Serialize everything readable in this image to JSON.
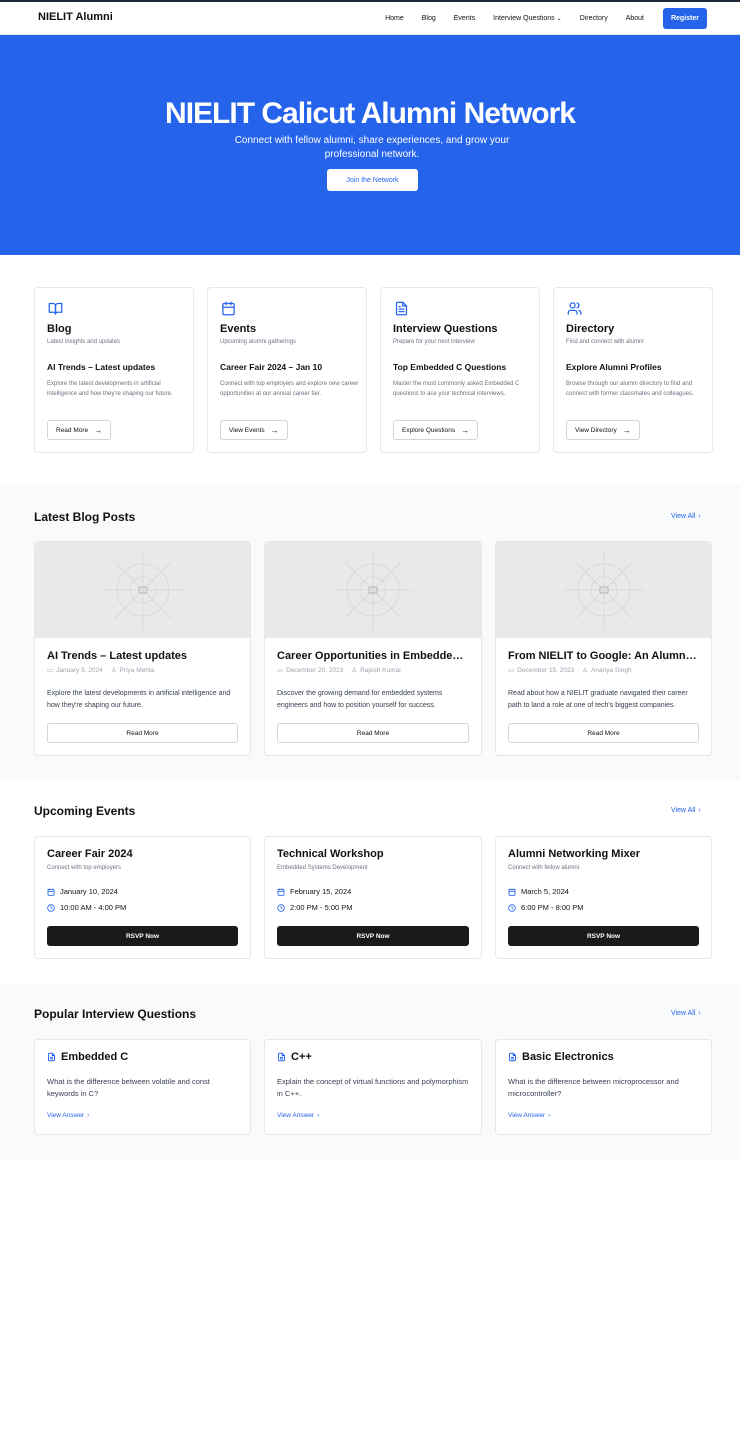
{
  "nav": {
    "logo": "NIELIT Alumni",
    "links": [
      "Home",
      "Blog",
      "Events",
      "Interview Questions",
      "Directory",
      "About"
    ],
    "register": "Register"
  },
  "hero": {
    "title": "NIELIT Calicut Alumni Network",
    "subtitle": "Connect with fellow alumni, share experiences, and grow your professional network.",
    "button": "Join the Network"
  },
  "features": [
    {
      "icon": "book-open-icon",
      "title": "Blog",
      "subtitle": "Latest insights and updates",
      "heading": "AI Trends – Latest updates",
      "description": "Explore the latest developments in artificial intelligence and how they're shaping our future.",
      "button": "Read More"
    },
    {
      "icon": "calendar-icon",
      "title": "Events",
      "subtitle": "Upcoming alumni gatherings",
      "heading": "Career Fair 2024 – Jan 10",
      "description": "Connect with top employers and explore new career opportunities at our annual career fair.",
      "button": "View Events"
    },
    {
      "icon": "file-text-icon",
      "title": "Interview Questions",
      "subtitle": "Prepare for your next interview",
      "heading": "Top Embedded C Questions",
      "description": "Master the most commonly asked Embedded C questions to ace your technical interviews.",
      "button": "Explore Questions"
    },
    {
      "icon": "users-icon",
      "title": "Directory",
      "subtitle": "Find and connect with alumni",
      "heading": "Explore Alumni Profiles",
      "description": "Browse through our alumni directory to find and connect with former classmates and colleagues.",
      "button": "View Directory"
    }
  ],
  "blog": {
    "title": "Latest Blog Posts",
    "view_all": "View All",
    "posts": [
      {
        "title": "AI Trends – Latest updates",
        "date": "January 5, 2024",
        "author": "Priya Mehta",
        "excerpt": "Explore the latest developments in artificial intelligence and how they're shaping our future.",
        "button": "Read More"
      },
      {
        "title": "Career Opportunities in Embedded Systems",
        "date": "December 20, 2023",
        "author": "Rajesh Kumar",
        "excerpt": "Discover the growing demand for embedded systems engineers and how to position yourself for success.",
        "button": "Read More"
      },
      {
        "title": "From NIELIT to Google: An Alumni Success Story",
        "date": "December 15, 2023",
        "author": "Ananya Singh",
        "excerpt": "Read about how a NIELIT graduate navigated their career path to land a role at one of tech's biggest companies.",
        "button": "Read More"
      }
    ]
  },
  "events": {
    "title": "Upcoming Events",
    "view_all": "View All",
    "items": [
      {
        "title": "Career Fair 2024",
        "subtitle": "Connect with top employers",
        "date": "January 10, 2024",
        "time": "10:00 AM - 4:00 PM",
        "button": "RSVP Now"
      },
      {
        "title": "Technical Workshop",
        "subtitle": "Embedded Systems Development",
        "date": "February 15, 2024",
        "time": "2:00 PM - 5:00 PM",
        "button": "RSVP Now"
      },
      {
        "title": "Alumni Networking Mixer",
        "subtitle": "Connect with fellow alumni",
        "date": "March 5, 2024",
        "time": "6:00 PM - 8:00 PM",
        "button": "RSVP Now"
      }
    ]
  },
  "questions": {
    "title": "Popular Interview Questions",
    "view_all": "View All",
    "items": [
      {
        "title": "Embedded C",
        "question": "What is the difference between volatile and const keywords in C?",
        "link": "View Answer"
      },
      {
        "title": "C++",
        "question": "Explain the concept of virtual functions and polymorphism in C++.",
        "link": "View Answer"
      },
      {
        "title": "Basic Electronics",
        "question": "What is the difference between microprocessor and microcontroller?",
        "link": "View Answer"
      }
    ]
  },
  "colors": {
    "accent": "#2563eb",
    "dark_button": "#1a1a1a",
    "muted": "#6b7280",
    "section_bg": "#f9fafb"
  }
}
